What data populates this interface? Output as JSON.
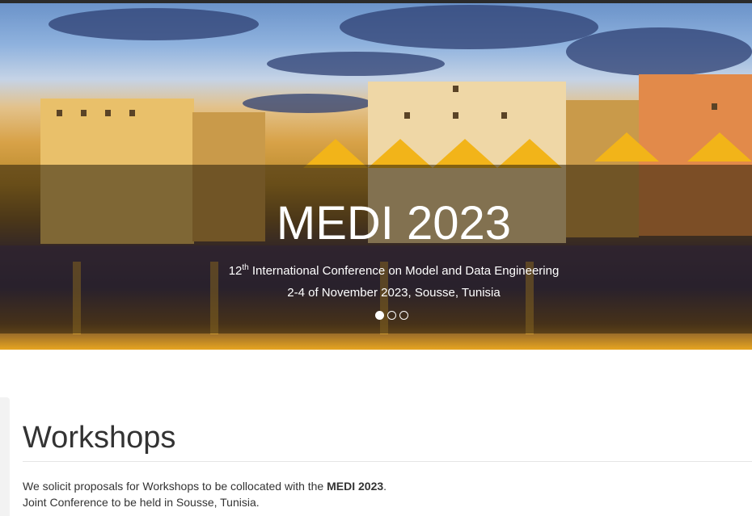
{
  "hero": {
    "title": "MEDI 2023",
    "subtitle_ordinal": "12",
    "subtitle_sup": "th",
    "subtitle_rest": " International Conference on Model and Data Engineering",
    "date_location": "2-4 of November 2023, Sousse, Tunisia",
    "carousel": {
      "slides": 3,
      "active_index": 0
    }
  },
  "section": {
    "title": "Workshops",
    "line1_prefix": "We solicit proposals for Workshops to be collocated with the ",
    "line1_bold": "MEDI 2023",
    "line1_suffix": ".",
    "line2": "Joint Conference to be held in Sousse, Tunisia."
  }
}
